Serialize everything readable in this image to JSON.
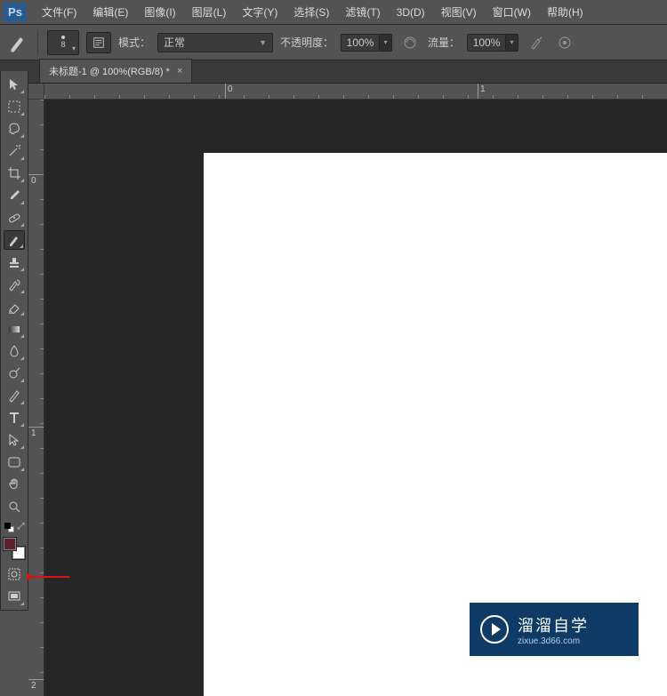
{
  "app": {
    "logo": "Ps"
  },
  "menu": {
    "items": [
      "文件(F)",
      "编辑(E)",
      "图像(I)",
      "图层(L)",
      "文字(Y)",
      "选择(S)",
      "滤镜(T)",
      "3D(D)",
      "视图(V)",
      "窗口(W)",
      "帮助(H)"
    ]
  },
  "options": {
    "brush_size": "8",
    "mode_label": "模式：",
    "mode_value": "正常",
    "opacity_label": "不透明度：",
    "opacity_value": "100%",
    "flow_label": "流量：",
    "flow_value": "100%"
  },
  "document": {
    "tab_title": "未标题-1 @ 100%(RGB/8) *"
  },
  "rulers": {
    "h": [
      {
        "pos": 203,
        "label": "0"
      },
      {
        "pos": 487,
        "label": "1"
      }
    ],
    "v": [
      {
        "pos": 84,
        "label": "0"
      },
      {
        "pos": 368,
        "label": "1"
      },
      {
        "pos": 652,
        "label": "2"
      }
    ]
  },
  "colors": {
    "foreground": "#5b222c",
    "background": "#ffffff"
  },
  "tools": [
    {
      "name": "move-tool",
      "glyph": "move",
      "more": true
    },
    {
      "name": "marquee-tool",
      "glyph": "marquee",
      "more": true
    },
    {
      "name": "lasso-tool",
      "glyph": "lasso",
      "more": true
    },
    {
      "name": "quick-select-tool",
      "glyph": "wand",
      "more": true
    },
    {
      "name": "crop-tool",
      "glyph": "crop",
      "more": true
    },
    {
      "name": "eyedropper-tool",
      "glyph": "eyedrop",
      "more": true
    },
    {
      "name": "healing-brush-tool",
      "glyph": "bandaid",
      "more": true
    },
    {
      "name": "brush-tool",
      "glyph": "brush",
      "more": true,
      "selected": true
    },
    {
      "name": "clone-stamp-tool",
      "glyph": "stamp",
      "more": true
    },
    {
      "name": "history-brush-tool",
      "glyph": "histbrush",
      "more": true
    },
    {
      "name": "eraser-tool",
      "glyph": "eraser",
      "more": true
    },
    {
      "name": "gradient-tool",
      "glyph": "gradient",
      "more": true
    },
    {
      "name": "blur-tool",
      "glyph": "blur",
      "more": true
    },
    {
      "name": "dodge-tool",
      "glyph": "dodge",
      "more": true
    },
    {
      "name": "pen-tool",
      "glyph": "pen",
      "more": true
    },
    {
      "name": "type-tool",
      "glyph": "type",
      "more": true
    },
    {
      "name": "path-select-tool",
      "glyph": "pathsel",
      "more": true
    },
    {
      "name": "shape-tool",
      "glyph": "shape",
      "more": true
    },
    {
      "name": "hand-tool",
      "glyph": "hand",
      "more": false
    },
    {
      "name": "zoom-tool",
      "glyph": "zoom",
      "more": false
    }
  ],
  "watermark": {
    "cn": "溜溜自学",
    "url": "zixue.3d66.com"
  }
}
